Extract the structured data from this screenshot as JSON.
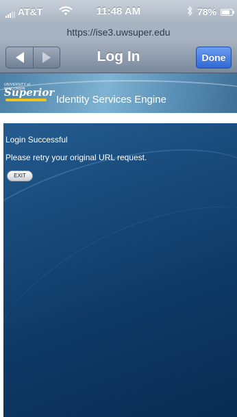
{
  "status_bar": {
    "carrier": "AT&T",
    "time": "11:48 AM",
    "battery_percent": "78%",
    "battery_level": 0.78
  },
  "browser": {
    "url": "https://ise3.uwsuper.edu",
    "title": "Log In",
    "done_label": "Done"
  },
  "banner": {
    "logo_small_text": "UNIVERSITY of WISCONSIN",
    "logo_word": "Superior",
    "title": "Identity Services Engine"
  },
  "content": {
    "message_1": "Login Successful",
    "message_2": "Please retry your original URL request.",
    "exit_label": "EXIT"
  },
  "colors": {
    "done_button": "#2f69d6",
    "content_background": "#0f3a66",
    "logo_swoosh": "#f0c419"
  }
}
